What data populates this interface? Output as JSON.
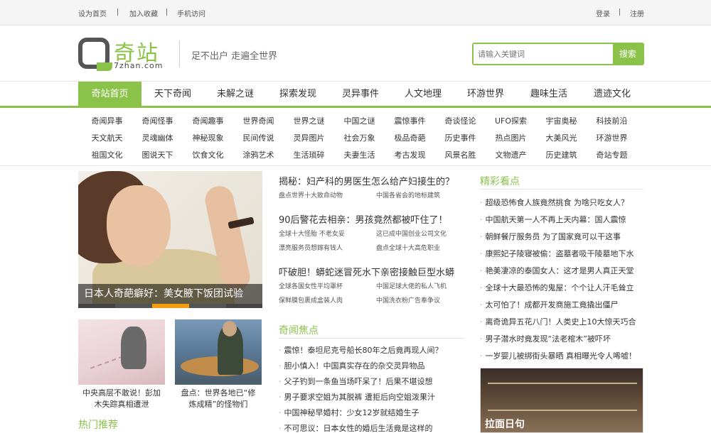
{
  "topbar": {
    "set_home": "设为首页",
    "add_fav": "加入收藏",
    "mobile": "手机访问",
    "login": "登录",
    "register": "注册"
  },
  "header": {
    "logo_cn": "奇站",
    "logo_en": "7zhan.com",
    "slogan": "足不出户 走遍全世界",
    "search_placeholder": "请输入关键词",
    "search_button": "搜索"
  },
  "nav": [
    "奇站首页",
    "天下奇闻",
    "未解之谜",
    "探索发现",
    "灵异事件",
    "人文地理",
    "环游世界",
    "趣味生活",
    "遗迹文化"
  ],
  "subnav": [
    [
      "奇闻异事",
      "奇闻怪事",
      "奇闻趣事",
      "世界奇闻",
      "世界之谜",
      "中国之谜",
      "震惊事件",
      "奇谈怪论",
      "UFO探索",
      "宇宙奥秘",
      "科技前沿"
    ],
    [
      "天文航天",
      "灵魂幽体",
      "神秘现象",
      "民间传说",
      "灵异图片",
      "社会万象",
      "极品奇葩",
      "历史事件",
      "热点图片",
      "大美风光",
      "环游世界"
    ],
    [
      "祖国文化",
      "图说天下",
      "饮食文化",
      "涂鸦艺术",
      "生活琐碎",
      "夫妻生活",
      "考古发现",
      "风景名胜",
      "文物遗产",
      "历史建筑",
      "奇站专题"
    ]
  ],
  "hero": {
    "caption": "日本人奇葩癖好：美女腋下饭团试验"
  },
  "thumbs": [
    {
      "caption_l1": "中央高层不敢说！彭加",
      "caption_l2": "木失踪真相遭泄"
    },
    {
      "caption_l1": "盘点：世界各地已“修",
      "caption_l2": "炼成精”的怪物们"
    }
  ],
  "hot_recommend": "热门推荐",
  "headlines": [
    {
      "title": "揭秘：妇产科的男医生怎么给产妇接生的？",
      "subs": [
        "盘点世界十大致命动物",
        "中国各省会的地标建筑"
      ]
    },
    {
      "title": "90后警花去相亲：男孩竟然都被吓住了！",
      "subs": [
        "全球十大怪胎 不老女妥",
        "这已成中国创业公司文化",
        "漂亮服务员想嫁有钱人",
        "盘点全球十大高危职业"
      ]
    },
    {
      "title": "吓破胆！蟒蛇迷冒死水下亲密接触巨型水蟒",
      "subs": [
        "全球各国女性平均罩杯",
        "中国足球大佬的私人飞机",
        "保鲜膜包裹成盒装人肉",
        "中国洗衣粉广告奉争议"
      ]
    }
  ],
  "focus": {
    "title": "奇闻焦点",
    "items": [
      "震惊！泰坦尼克号船长80年之后竟再现人间？",
      "胆小慎入！中国真实存在的杂交灵异物品",
      "父子钓到一条鱼当场吓呆了！后果不堪设想",
      "男子要求空姐为其脱裤 遭拒后向空姐泼果汁",
      "中国神秘早婚村：少女12岁就结婚生子",
      "不可思议：日本女性的婚后生活竟是这样的"
    ]
  },
  "highlights": {
    "title": "精彩看点",
    "items": [
      "超级恐怖食人族竟然挑食 为啥只吃女人？",
      "中国航天第一人不再上天内幕：国人震惊",
      "朝鲜餐厅服务员 为了国家竟可以干这事",
      "康熙妃子陵寝被偷：盗墓者吸干陵墓地下水",
      "艳美凄凉的泰国女人：这才是男人真正天堂",
      "全球十大最恐怖的鬼屋：个个让人汗毛耸立",
      "太可怕了！成都开发商施工竟撬出僵尸",
      "离奇诡异五花八门！人类史上10大惊天巧合",
      "男子潜水时竟发现“法老棺木”被吓坏",
      "一岁婴儿被绑街头暴晒 真相曝光令人唏嘘！"
    ],
    "image_label": "拉面日句"
  },
  "colors": {
    "accent": "#8bc34a",
    "hero_dot_active": "#f39c12"
  }
}
